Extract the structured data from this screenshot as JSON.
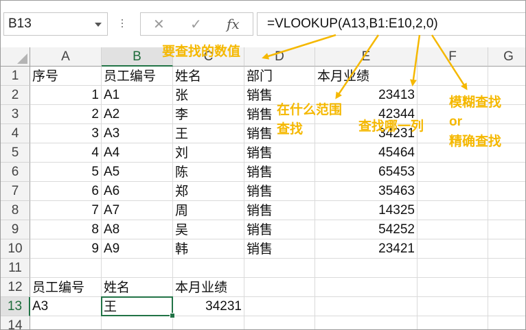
{
  "formula_bar": {
    "name_box": "B13",
    "cancel_glyph": "✕",
    "enter_glyph": "✓",
    "fx_glyph": "fx",
    "formula": "=VLOOKUP(A13,B1:E10,2,0)"
  },
  "columns": [
    "A",
    "B",
    "C",
    "D",
    "E",
    "F",
    "G"
  ],
  "selected_column": "B",
  "rows": [
    "1",
    "2",
    "3",
    "4",
    "5",
    "6",
    "7",
    "8",
    "9",
    "10",
    "11",
    "12",
    "13",
    "14"
  ],
  "selected_row": "13",
  "cells": [
    {
      "ref": "A1",
      "value": "序号",
      "align": "left"
    },
    {
      "ref": "B1",
      "value": "员工编号",
      "align": "left"
    },
    {
      "ref": "C1",
      "value": "姓名",
      "align": "left"
    },
    {
      "ref": "D1",
      "value": "部门",
      "align": "left"
    },
    {
      "ref": "E1",
      "value": "本月业绩",
      "align": "left"
    },
    {
      "ref": "A2",
      "value": "1",
      "align": "right"
    },
    {
      "ref": "B2",
      "value": "A1",
      "align": "left"
    },
    {
      "ref": "C2",
      "value": "张",
      "align": "left"
    },
    {
      "ref": "D2",
      "value": "销售",
      "align": "left"
    },
    {
      "ref": "E2",
      "value": "23413",
      "align": "right"
    },
    {
      "ref": "A3",
      "value": "2",
      "align": "right"
    },
    {
      "ref": "B3",
      "value": "A2",
      "align": "left"
    },
    {
      "ref": "C3",
      "value": "李",
      "align": "left"
    },
    {
      "ref": "D3",
      "value": "销售",
      "align": "left"
    },
    {
      "ref": "E3",
      "value": "42344",
      "align": "right"
    },
    {
      "ref": "A4",
      "value": "3",
      "align": "right"
    },
    {
      "ref": "B4",
      "value": "A3",
      "align": "left"
    },
    {
      "ref": "C4",
      "value": "王",
      "align": "left"
    },
    {
      "ref": "D4",
      "value": "销售",
      "align": "left"
    },
    {
      "ref": "E4",
      "value": "34231",
      "align": "right"
    },
    {
      "ref": "A5",
      "value": "4",
      "align": "right"
    },
    {
      "ref": "B5",
      "value": "A4",
      "align": "left"
    },
    {
      "ref": "C5",
      "value": "刘",
      "align": "left"
    },
    {
      "ref": "D5",
      "value": "销售",
      "align": "left"
    },
    {
      "ref": "E5",
      "value": "45464",
      "align": "right"
    },
    {
      "ref": "A6",
      "value": "5",
      "align": "right"
    },
    {
      "ref": "B6",
      "value": "A5",
      "align": "left"
    },
    {
      "ref": "C6",
      "value": "陈",
      "align": "left"
    },
    {
      "ref": "D6",
      "value": "销售",
      "align": "left"
    },
    {
      "ref": "E6",
      "value": "65453",
      "align": "right"
    },
    {
      "ref": "A7",
      "value": "6",
      "align": "right"
    },
    {
      "ref": "B7",
      "value": "A6",
      "align": "left"
    },
    {
      "ref": "C7",
      "value": "郑",
      "align": "left"
    },
    {
      "ref": "D7",
      "value": "销售",
      "align": "left"
    },
    {
      "ref": "E7",
      "value": "35463",
      "align": "right"
    },
    {
      "ref": "A8",
      "value": "7",
      "align": "right"
    },
    {
      "ref": "B8",
      "value": "A7",
      "align": "left"
    },
    {
      "ref": "C8",
      "value": "周",
      "align": "left"
    },
    {
      "ref": "D8",
      "value": "销售",
      "align": "left"
    },
    {
      "ref": "E8",
      "value": "14325",
      "align": "right"
    },
    {
      "ref": "A9",
      "value": "8",
      "align": "right"
    },
    {
      "ref": "B9",
      "value": "A8",
      "align": "left"
    },
    {
      "ref": "C9",
      "value": "吴",
      "align": "left"
    },
    {
      "ref": "D9",
      "value": "销售",
      "align": "left"
    },
    {
      "ref": "E9",
      "value": "54252",
      "align": "right"
    },
    {
      "ref": "A10",
      "value": "9",
      "align": "right"
    },
    {
      "ref": "B10",
      "value": "A9",
      "align": "left"
    },
    {
      "ref": "C10",
      "value": "韩",
      "align": "left"
    },
    {
      "ref": "D10",
      "value": "销售",
      "align": "left"
    },
    {
      "ref": "E10",
      "value": "23421",
      "align": "right"
    },
    {
      "ref": "A12",
      "value": "员工编号",
      "align": "left"
    },
    {
      "ref": "B12",
      "value": "姓名",
      "align": "left"
    },
    {
      "ref": "C12",
      "value": "本月业绩",
      "align": "left"
    },
    {
      "ref": "A13",
      "value": "A3",
      "align": "left"
    },
    {
      "ref": "B13",
      "value": "王",
      "align": "left"
    },
    {
      "ref": "C13",
      "value": "34231",
      "align": "right"
    }
  ],
  "active_cell": "B13",
  "annotations": {
    "lookup_value": "要查找的数值",
    "range_line1": "在什么范围",
    "range_line2": "查找",
    "column": "查找哪一列",
    "match_line1": "模糊查找",
    "match_line2": "or",
    "match_line3": "精确查找",
    "color": "#f5b800"
  },
  "colors": {
    "accent_green": "#217346",
    "header_bg": "#f3f3f3",
    "selected_header_bg": "#e1e1e1",
    "gridline": "#dadada"
  }
}
